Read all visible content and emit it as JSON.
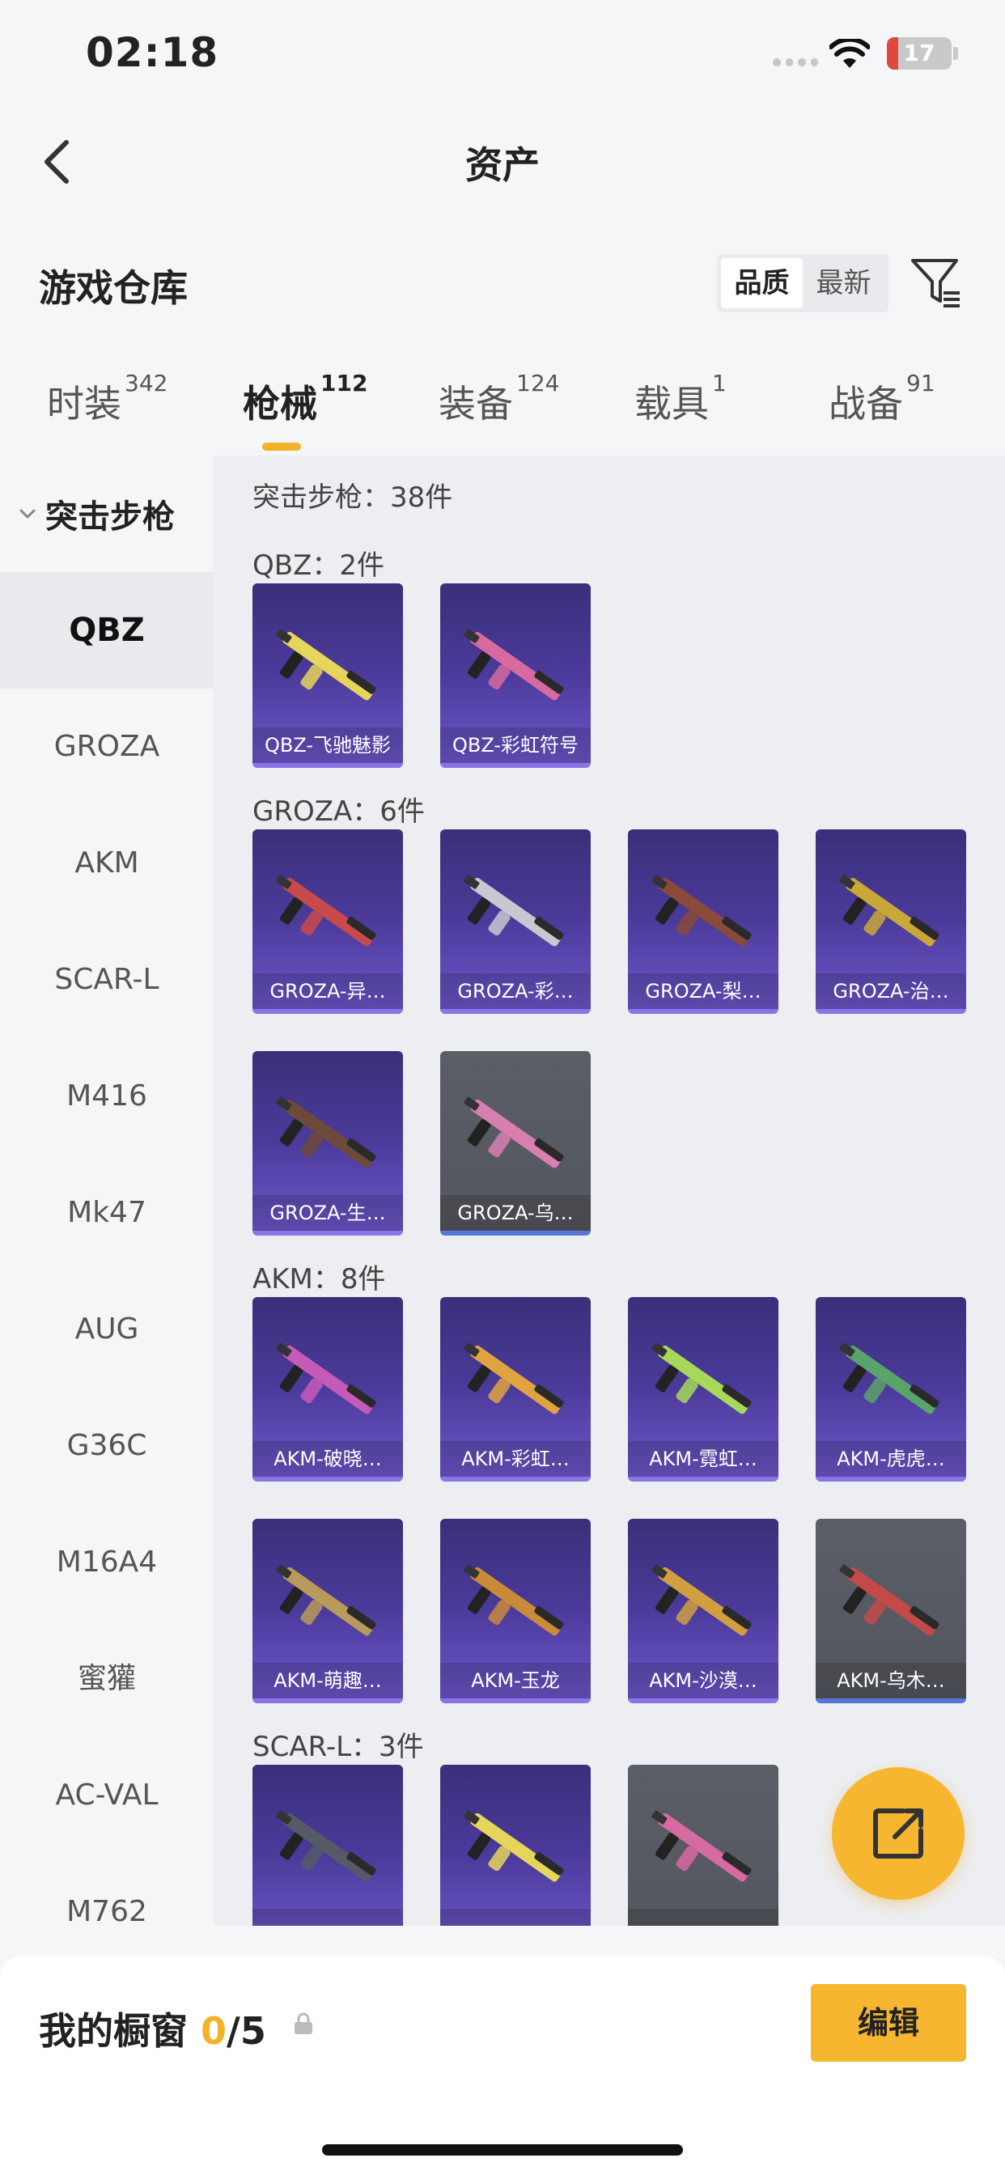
{
  "status_bar": {
    "time": "02:18",
    "battery": "17",
    "battery_level": 0.17
  },
  "nav": {
    "title": "资产"
  },
  "warehouse": {
    "heading": "游戏仓库",
    "sort_options": [
      "品质",
      "最新"
    ],
    "active_sort": "品质"
  },
  "tabs": [
    {
      "label": "时装",
      "count": "342"
    },
    {
      "label": "枪械",
      "count": "112",
      "active": true
    },
    {
      "label": "装备",
      "count": "124"
    },
    {
      "label": "载具",
      "count": "1"
    },
    {
      "label": "战备",
      "count": "91"
    }
  ],
  "sidebar": {
    "category": "突击步枪",
    "items": [
      "QBZ",
      "GROZA",
      "AKM",
      "SCAR-L",
      "M416",
      "Mk47",
      "AUG",
      "G36C",
      "M16A4",
      "蜜獾",
      "AC-VAL",
      "M762"
    ],
    "active_item": "QBZ"
  },
  "content": {
    "summary": "突击步枪：38件",
    "groups": [
      {
        "title": "QBZ：2件",
        "items": [
          {
            "label": "QBZ-飞驰魅影",
            "style": "purple"
          },
          {
            "label": "QBZ-彩虹符号",
            "style": "purple"
          }
        ]
      },
      {
        "title": "GROZA：6件",
        "items": [
          {
            "label": "GROZA-异…",
            "style": "purple"
          },
          {
            "label": "GROZA-彩…",
            "style": "purple"
          },
          {
            "label": "GROZA-梨…",
            "style": "purple"
          },
          {
            "label": "GROZA-治…",
            "style": "purple"
          },
          {
            "label": "GROZA-生…",
            "style": "purple"
          },
          {
            "label": "GROZA-乌…",
            "style": "gray"
          }
        ]
      },
      {
        "title": "AKM：8件",
        "items": [
          {
            "label": "AKM-破晓…",
            "style": "purple"
          },
          {
            "label": "AKM-彩虹…",
            "style": "purple"
          },
          {
            "label": "AKM-霓虹…",
            "style": "purple"
          },
          {
            "label": "AKM-虎虎…",
            "style": "purple"
          },
          {
            "label": "AKM-萌趣…",
            "style": "purple"
          },
          {
            "label": "AKM-玉龙",
            "style": "purple"
          },
          {
            "label": "AKM-沙漠…",
            "style": "purple"
          },
          {
            "label": "AKM-乌木…",
            "style": "gray"
          }
        ]
      },
      {
        "title": "SCAR-L：3件",
        "items": [
          {
            "label": "",
            "style": "purple"
          },
          {
            "label": "",
            "style": "purple"
          },
          {
            "label": "",
            "style": "gray"
          }
        ]
      }
    ]
  },
  "bottom_bar": {
    "label": "我的橱窗",
    "current": "0",
    "total": "/5",
    "edit_label": "编辑"
  },
  "colors": {
    "accent": "#f6b62f",
    "card_purple": "#4b3a9a",
    "card_gray": "#5b5e67"
  }
}
